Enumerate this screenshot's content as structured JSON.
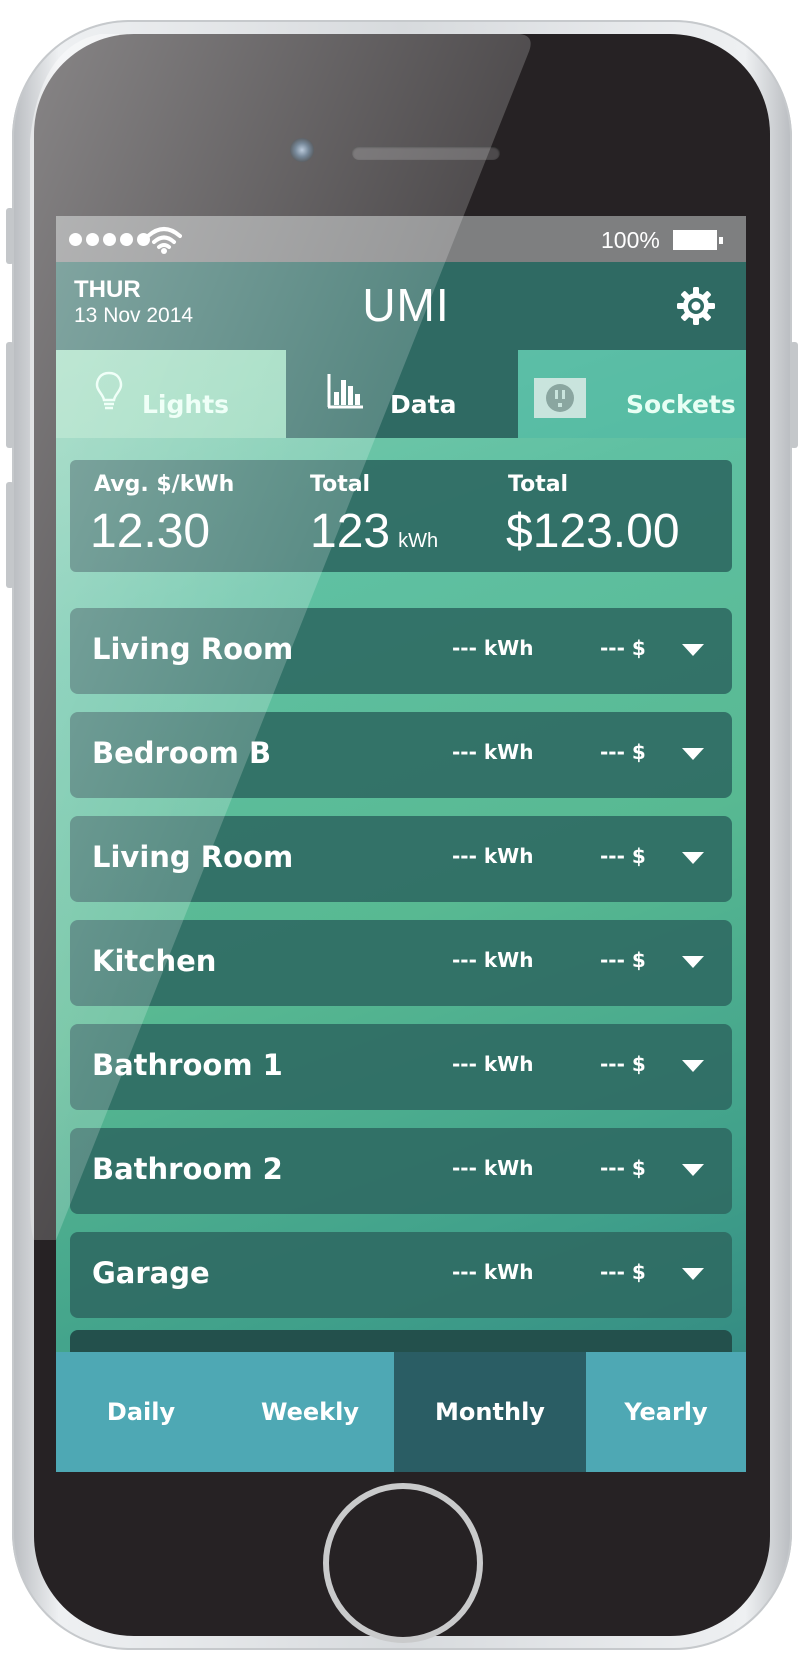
{
  "status_bar": {
    "battery_percent": "100%",
    "signal_dots": 5
  },
  "header": {
    "day": "THUR",
    "date": "13 Nov 2014",
    "title": "UMI",
    "settings_icon": "gear-icon"
  },
  "tabs": [
    {
      "label": "Lights",
      "icon": "lightbulb-icon",
      "active": false
    },
    {
      "label": "Data",
      "icon": "bar-chart-icon",
      "active": true
    },
    {
      "label": "Sockets",
      "icon": "socket-icon",
      "active": false
    }
  ],
  "summary": {
    "avg_label": "Avg. $/kWh",
    "avg_value": "12.30",
    "total_kwh_label": "Total",
    "total_kwh_value": "123",
    "total_kwh_unit": "kWh",
    "total_cost_label": "Total",
    "total_cost_value": "$123.00"
  },
  "rooms": [
    {
      "name": "Living Room",
      "kwh": "--- kWh",
      "cost": "--- $"
    },
    {
      "name": "Bedroom B",
      "kwh": "--- kWh",
      "cost": "--- $"
    },
    {
      "name": "Living Room",
      "kwh": "--- kWh",
      "cost": "--- $"
    },
    {
      "name": "Kitchen",
      "kwh": "--- kWh",
      "cost": "--- $"
    },
    {
      "name": "Bathroom 1",
      "kwh": "--- kWh",
      "cost": "--- $"
    },
    {
      "name": "Bathroom 2",
      "kwh": "---  kWh",
      "cost": "--- $"
    },
    {
      "name": "Garage",
      "kwh": "--- kWh",
      "cost": "--- $"
    }
  ],
  "periods": [
    {
      "label": "Daily",
      "active": false
    },
    {
      "label": "Weekly",
      "active": false
    },
    {
      "label": "Monthly",
      "active": true
    },
    {
      "label": "Yearly",
      "active": false
    }
  ],
  "colors": {
    "header_bg": "#2f6a63",
    "active_period_bg": "#2a5d64",
    "period_bar_bg": "#4ea8b4",
    "row_bg": "#2f6a63"
  }
}
